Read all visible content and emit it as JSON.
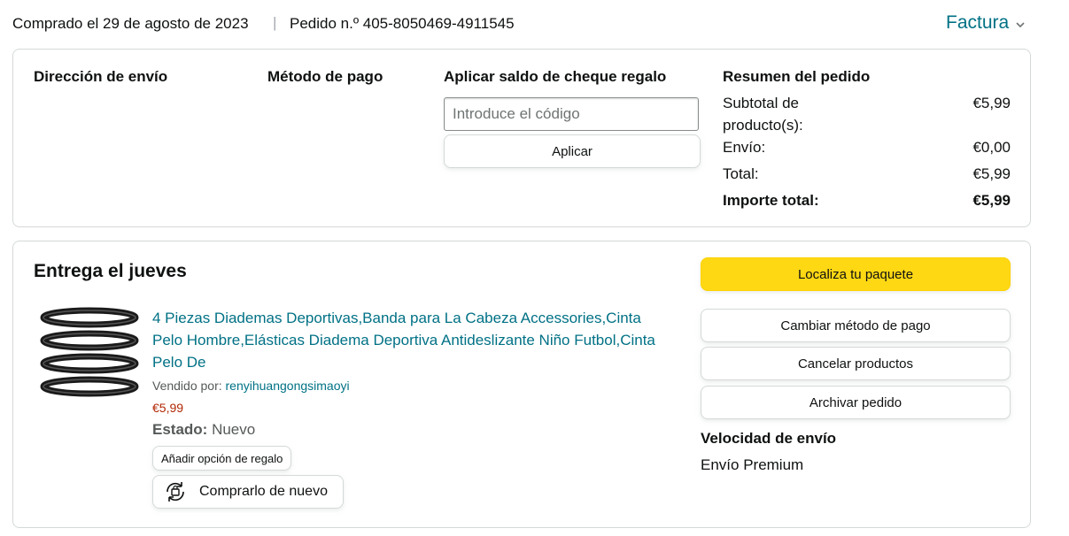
{
  "header": {
    "purchased": "Comprado el 29 de agosto de 2023",
    "separator": "|",
    "order_number": "Pedido n.º 405-8050469-4911545",
    "invoice": "Factura"
  },
  "info": {
    "shipping_heading": "Dirección de envío",
    "payment_heading": "Método de pago",
    "gift_heading": "Aplicar saldo de cheque regalo",
    "gift_placeholder": "Introduce el código",
    "apply_label": "Aplicar",
    "summary_heading": "Resumen del pedido",
    "summary": [
      {
        "label": "Subtotal de producto(s):",
        "value": "€5,99"
      },
      {
        "label": "Envío:",
        "value": "€0,00"
      },
      {
        "label": "Total:",
        "value": "€5,99"
      },
      {
        "label": "Importe total:",
        "value": "€5,99"
      }
    ]
  },
  "delivery": {
    "heading": "Entrega el jueves",
    "product_title": "4 Piezas Diademas Deportivas,Banda para La Cabeza Accessories,Cinta Pelo Hombre,Elásticas Diadema Deportiva Antideslizante Niño Futbol,Cinta Pelo De",
    "sold_by_label": "Vendido por:",
    "seller": "renyihuangongsimaoyi",
    "price": "€5,99",
    "state_label": "Estado:",
    "state_value": "Nuevo",
    "gift_option": "Añadir opción de regalo",
    "buy_again": "Comprarlo de nuevo",
    "buy_again_icon": "buy-again-icon",
    "actions": {
      "track": "Localiza tu paquete",
      "change_payment": "Cambiar método de pago",
      "cancel": "Cancelar productos",
      "archive": "Archivar pedido"
    },
    "speed_heading": "Velocidad de envío",
    "speed_value": "Envío Premium"
  },
  "colors": {
    "link": "#007185",
    "price": "#b12704",
    "primary_button": "#ffd814",
    "border": "#d5d9d9"
  }
}
